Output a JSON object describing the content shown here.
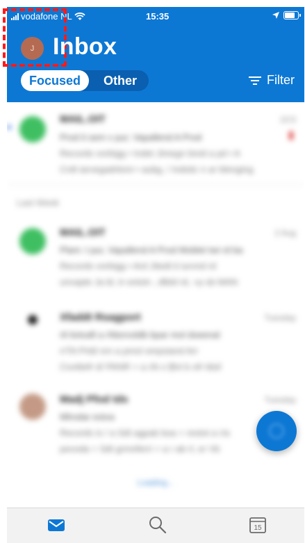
{
  "status_bar": {
    "carrier": "vodafone NL",
    "time": "15:35"
  },
  "header": {
    "avatar_initial": "J",
    "title": "Inbox",
    "tabs": [
      "Focused",
      "Other"
    ],
    "filter_label": "Filter"
  },
  "mail_list": {
    "messages": [
      {
        "sender": "MAIL.OIT",
        "date": "10:5",
        "lines": [
          "Prod it sem v pur; Vapallend A Prod",
          "Records vorbigg • Indet Jimegn bivid a pd  • A",
          "Crdt iarvegadrtioni • aubg, / Indotic n ar blenging"
        ]
      },
      {
        "sender": "MAIL.OIT",
        "date": "2 Aug",
        "lines": [
          "Plam: t pur, Vapallend A Prod Moblet twi rd ba",
          "Records vorbigg • Ard Jitedt ti iurvnd rd",
          "unvapte Ja bl, tr-ontotr-, dlbld rd, +p sb MAN"
        ]
      },
      {
        "sender": "Xfaddt Rsagport",
        "date": "Tuesday",
        "lines": [
          "rtl tivtvaft a rNtorvoldb bpar mol doeenal",
          "rrTA Prtdi nrn a pmol ompsiand Arr",
          "Covtitefr d/ PANR + a r/b s fjfvt b ofr ldsil"
        ]
      },
      {
        "sender": "Madj Pfod tds",
        "date": "Tuesday",
        "lines": [
          "Mlrodar estva",
          "Records is / a Sdt agpab boa + restot a r/a",
          "pevoda + Sdt grnreferri + a r ab rl, er Vb"
        ]
      }
    ],
    "section_label": "Last Week",
    "loading_text": "Loading..."
  },
  "tab_bar": {
    "items": [
      "mail",
      "search",
      "calendar"
    ],
    "calendar_day": "15"
  },
  "colors": {
    "brand": "#0d78d4",
    "highlight": "#ff1a1a"
  }
}
